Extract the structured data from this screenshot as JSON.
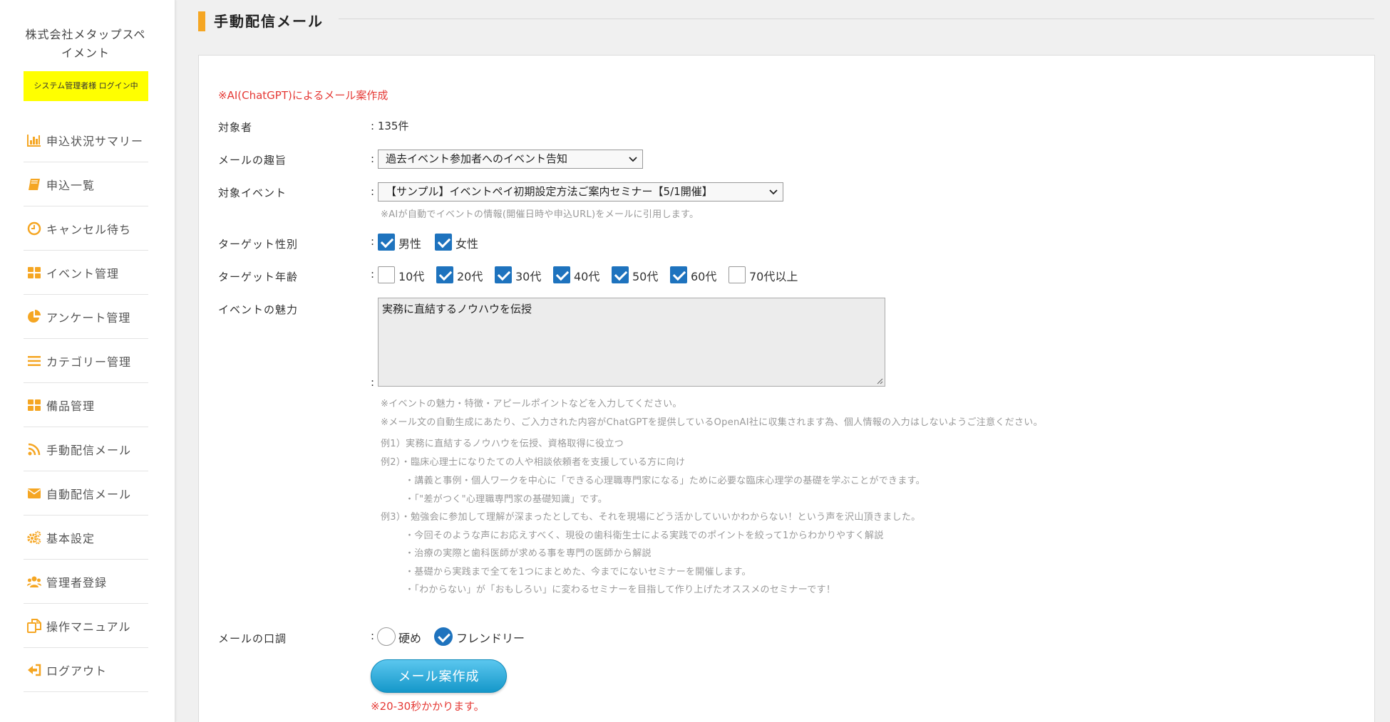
{
  "sidebar": {
    "company_line1": "株式会社メタップスペ",
    "company_line2": "イメント",
    "login_status": "システム管理者様 ログイン中",
    "items": [
      {
        "label": "申込状況サマリー",
        "icon": "bar-chart-icon"
      },
      {
        "label": "申込一覧",
        "icon": "book-icon"
      },
      {
        "label": "キャンセル待ち",
        "icon": "clock-icon"
      },
      {
        "label": "イベント管理",
        "icon": "grid-icon"
      },
      {
        "label": "アンケート管理",
        "icon": "pie-chart-icon"
      },
      {
        "label": "カテゴリー管理",
        "icon": "list-icon"
      },
      {
        "label": "備品管理",
        "icon": "grid-icon"
      },
      {
        "label": "手動配信メール",
        "icon": "rss-icon"
      },
      {
        "label": "自動配信メール",
        "icon": "envelope-icon"
      },
      {
        "label": "基本設定",
        "icon": "gears-icon"
      },
      {
        "label": "管理者登録",
        "icon": "users-icon"
      },
      {
        "label": "操作マニュアル",
        "icon": "copy-icon"
      },
      {
        "label": "ログアウト",
        "icon": "sign-out-icon"
      }
    ]
  },
  "header": {
    "title": "手動配信メール"
  },
  "form": {
    "ai_heading": "※AI(ChatGPT)によるメール案作成",
    "colon": ":",
    "target": {
      "label": "対象者",
      "value": ": 135件"
    },
    "purpose": {
      "label": "メールの趣旨",
      "selected": "過去イベント参加者へのイベント告知"
    },
    "event": {
      "label": "対象イベント",
      "selected": "【サンプル】イベントペイ初期設定方法ご案内セミナー【5/1開催】",
      "note": "※AIが自動でイベントの情報(開催日時や申込URL)をメールに引用します。"
    },
    "gender": {
      "label": "ターゲット性別",
      "options": [
        {
          "label": "男性",
          "checked": true
        },
        {
          "label": "女性",
          "checked": true
        }
      ]
    },
    "age": {
      "label": "ターゲット年齢",
      "options": [
        {
          "label": "10代",
          "checked": false
        },
        {
          "label": "20代",
          "checked": true
        },
        {
          "label": "30代",
          "checked": true
        },
        {
          "label": "40代",
          "checked": true
        },
        {
          "label": "50代",
          "checked": true
        },
        {
          "label": "60代",
          "checked": true
        },
        {
          "label": "70代以上",
          "checked": false
        }
      ]
    },
    "appeal": {
      "label": "イベントの魅力",
      "value": "実務に直結するノウハウを伝授",
      "notes": [
        "※イベントの魅力・特徴・アピールポイントなどを入力してください。",
        "※メール文の自動生成にあたり、ご入力された内容がChatGPTを提供しているOpenAI社に収集されます為、個人情報の入力はしないようご注意ください。",
        "例1）実務に直結するノウハウを伝授、資格取得に役立つ",
        "例2）・臨床心理士になりたての人や相談依頼者を支援している方に向け",
        "・講義と事例・個人ワークを中心に「できる心理職専門家になる」ために必要な臨床心理学の基礎を学ぶことができます。",
        "・「\"差がつく\"心理職専門家の基礎知識」です。",
        "例3）・勉強会に参加して理解が深まったとしても、それを現場にどう活かしていいかわからない！という声を沢山頂きました。",
        "・今回そのような声にお応えすべく、現役の歯科衛生士による実践でのポイントを絞って1からわかりやすく解説",
        "・治療の実際と歯科医師が求める事を専門の医師から解説",
        "・基礎から実践まで全てを1つにまとめた、今までにないセミナーを開催します。",
        "・「わからない」が「おもしろい」に変わるセミナーを目指して作り上げたオススメのセミナーです！"
      ]
    },
    "tone": {
      "label": "メールの口調",
      "options": [
        {
          "label": "硬め",
          "checked": false
        },
        {
          "label": "フレンドリー",
          "checked": true
        }
      ]
    },
    "submit_label": "メール案作成",
    "time_note": "※20-30秒かかります。"
  },
  "colors": {
    "accent": "#f5a623",
    "badge": "#ffff00",
    "checkbox": "#1e73be",
    "button": "#1597c9",
    "warning": "#e53935"
  }
}
